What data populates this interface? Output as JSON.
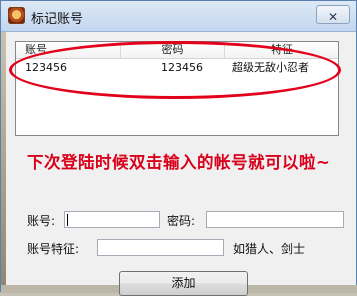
{
  "window": {
    "title": "标记账号",
    "close_symbol": "✕"
  },
  "list": {
    "columns": [
      "账号",
      "密码",
      "特征"
    ],
    "rows": [
      {
        "account": "123456",
        "password": "123456",
        "feature": "超级无敌小忍者"
      }
    ]
  },
  "annotation": {
    "text": "下次登陆时候双击输入的帐号就可以啦~",
    "color": "#d9001b"
  },
  "form": {
    "account_label": "账号:",
    "account_value": "",
    "password_label": "密码:",
    "password_value": "",
    "feature_label": "账号特征:",
    "feature_value": "",
    "feature_hint": "如猎人、剑士",
    "add_button_label": "添加"
  }
}
